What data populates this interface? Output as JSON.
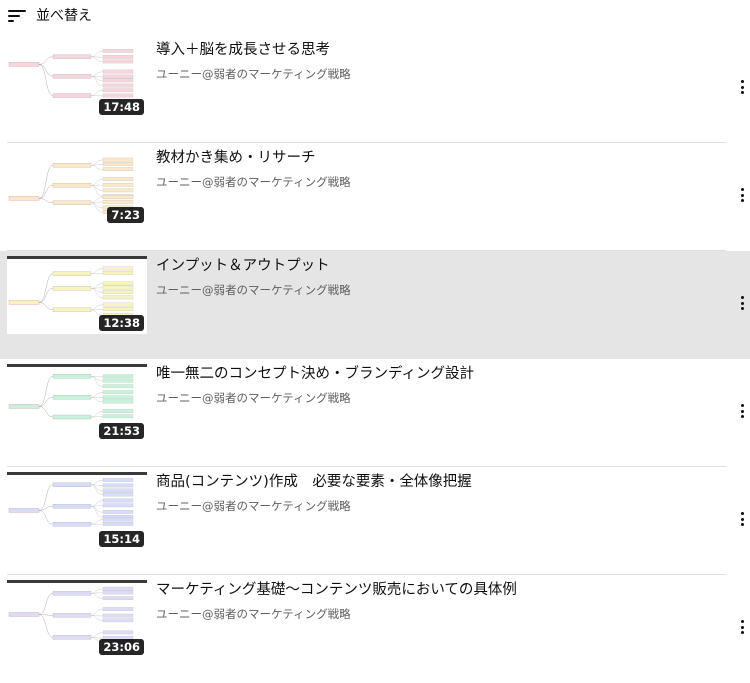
{
  "sort": {
    "label": "並べ替え",
    "icon": "sort-icon"
  },
  "videos": [
    {
      "title": "導入＋脳を成長させる思考",
      "channel": "ユーニー@弱者のマーケティング戦略",
      "duration": "17:48",
      "thumb_color": "#f6d6dc",
      "active": false
    },
    {
      "title": "教材かき集め・リサーチ",
      "channel": "ユーニー@弱者のマーケティング戦略",
      "duration": "7:23",
      "thumb_color": "#fbe8c8",
      "active": false
    },
    {
      "title": "インプット＆アウトプット",
      "channel": "ユーニー@弱者のマーケティング戦略",
      "duration": "12:38",
      "thumb_color": "#f8f4c0",
      "active": true
    },
    {
      "title": "唯一無二のコンセプト決め・ブランディング設計",
      "channel": "ユーニー@弱者のマーケティング戦略",
      "duration": "21:53",
      "thumb_color": "#c9f2dc",
      "active": false
    },
    {
      "title": "商品(コンテンツ)作成　必要な要素・全体像把握",
      "channel": "ユーニー@弱者のマーケティング戦略",
      "duration": "15:14",
      "thumb_color": "#d6dcfa",
      "active": false
    },
    {
      "title": "マーケティング基礎〜コンテンツ販売においての具体例",
      "channel": "ユーニー@弱者のマーケティング戦略",
      "duration": "23:06",
      "thumb_color": "#dcdcf6",
      "active": false
    }
  ]
}
